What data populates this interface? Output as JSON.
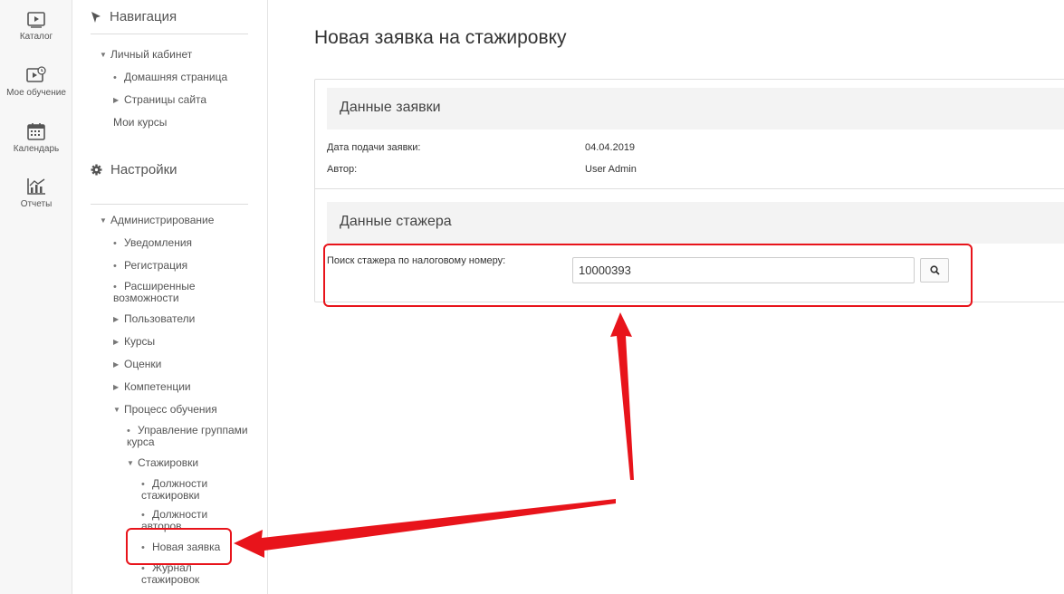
{
  "rail": {
    "items": [
      {
        "label": "Каталог",
        "icon": "catalog-icon"
      },
      {
        "label": "Мое обучение",
        "icon": "my-learning-icon"
      },
      {
        "label": "Календарь",
        "icon": "calendar-icon"
      },
      {
        "label": "Отчеты",
        "icon": "reports-icon"
      }
    ]
  },
  "nav": {
    "navigation_title": "Навигация",
    "settings_title": "Настройки",
    "dashboard": "Личный кабинет",
    "home_page": "Домашняя страница",
    "site_pages": "Страницы сайта",
    "my_courses": "Мои курсы",
    "administration": "Администрирование",
    "notifications": "Уведомления",
    "registration": "Регистрация",
    "advanced_features": "Расширенные возможности",
    "users": "Пользователи",
    "courses": "Курсы",
    "grades": "Оценки",
    "competencies": "Компетенции",
    "learning_process": "Процесс обучения",
    "course_groups": "Управление группами курса",
    "internships": "Стажировки",
    "internship_positions": "Должности стажировки",
    "author_positions": "Должности авторов",
    "new_request": "Новая заявка",
    "internship_log": "Журнал стажировок"
  },
  "main": {
    "title": "Новая заявка на стажировку",
    "request_section": "Данные заявки",
    "submit_date_label": "Дата подачи заявки:",
    "submit_date_value": "04.04.2019",
    "author_label": "Автор:",
    "author_value": "User Admin",
    "trainee_section": "Данные стажера",
    "search_label": "Поиск стажера по налоговому номеру:",
    "search_value": "10000393"
  },
  "colors": {
    "annotation": "#e8141b",
    "section_bg": "#f3f3f3"
  }
}
